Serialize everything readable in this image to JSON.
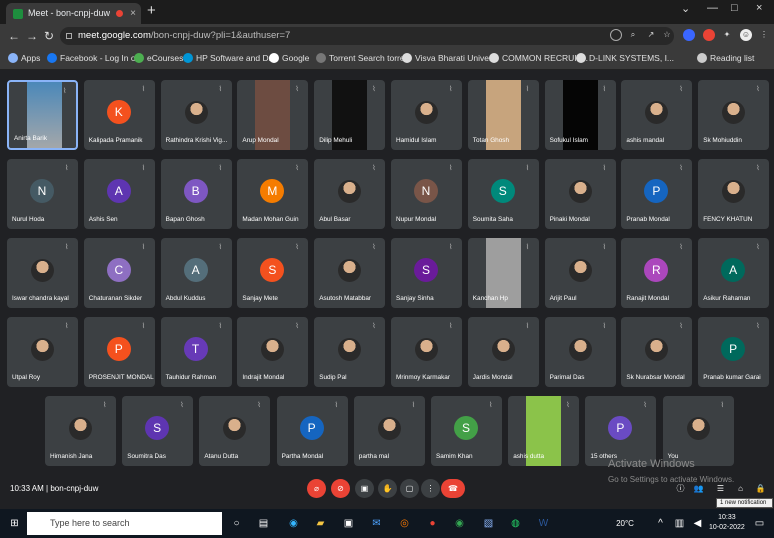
{
  "browser": {
    "tab_title": "Meet - bon-cnpj-duw",
    "url_host": "meet.google.com",
    "url_path": "/bon-cnpj-duw?pli=1&authuser=7",
    "bookmarks": [
      "Apps",
      "Facebook - Log In o...",
      "eCourses",
      "HP Software and Dr...",
      "Google",
      "Torrent Search torre...",
      "Visva Bharati Univer...",
      "COMMON RECRUIT...",
      "D-LINK SYSTEMS, I...",
      "Reading list"
    ]
  },
  "participants": [
    {
      "name": "Anirta Barik",
      "type": "self"
    },
    {
      "name": "Kalipada Pramanik",
      "initial": "K",
      "color": "#f4511e"
    },
    {
      "name": "Rathindra Krishi Vig...",
      "type": "photo"
    },
    {
      "name": "Arup Mondal",
      "type": "video",
      "video": "#6d4c41"
    },
    {
      "name": "Dilip Mehuli",
      "type": "video",
      "video": "#111111"
    },
    {
      "name": "Hamidul Islam",
      "type": "photo"
    },
    {
      "name": "Totan Ghosh",
      "type": "video",
      "video": "#c7a47d"
    },
    {
      "name": "Sofukul Islam",
      "type": "video",
      "video": "#050505"
    },
    {
      "name": "ashis mandal",
      "type": "photo"
    },
    {
      "name": "Sk Mohiuddin",
      "type": "photo"
    },
    {
      "name": "Nurul Hoda",
      "initial": "N",
      "color": "#455a64"
    },
    {
      "name": "Ashis Sen",
      "initial": "A",
      "color": "#5e35b1"
    },
    {
      "name": "Bapan Ghosh",
      "initial": "B",
      "color": "#7e57c2"
    },
    {
      "name": "Madan Mohan Guin",
      "initial": "M",
      "color": "#f57c00"
    },
    {
      "name": "Abul Basar",
      "type": "photo"
    },
    {
      "name": "Nupur Mondal",
      "initial": "N",
      "color": "#795548"
    },
    {
      "name": "Soumita Saha",
      "initial": "S",
      "color": "#00897b"
    },
    {
      "name": "Pinaki Mondal",
      "type": "photo"
    },
    {
      "name": "Pranab Mondal",
      "initial": "P",
      "color": "#1565c0"
    },
    {
      "name": "FENCY KHATUN",
      "type": "photo"
    },
    {
      "name": "Iswar chandra kayal",
      "type": "photo"
    },
    {
      "name": "Chaturanan Sikder",
      "initial": "C",
      "color": "#8e6fc2"
    },
    {
      "name": "Abdul Kuddus",
      "initial": "A",
      "color": "#546e7a"
    },
    {
      "name": "Sanjay Mete",
      "initial": "S",
      "color": "#f4511e"
    },
    {
      "name": "Asutosh Matabbar",
      "type": "photo"
    },
    {
      "name": "Sanjay Sinha",
      "initial": "S",
      "color": "#6a1b9a"
    },
    {
      "name": "Kanchan Hp",
      "type": "video",
      "video": "#9e9e9e"
    },
    {
      "name": "Arijit Paul",
      "type": "photo"
    },
    {
      "name": "Ranajit Mondal",
      "initial": "R",
      "color": "#ab47bc"
    },
    {
      "name": "Asikur Rahaman",
      "initial": "A",
      "color": "#00695c"
    },
    {
      "name": "Utpal Roy",
      "type": "photo"
    },
    {
      "name": "PROSENJIT MONDAL",
      "initial": "P",
      "color": "#f4511e"
    },
    {
      "name": "Tauhidur Rahman",
      "initial": "T",
      "color": "#673ab7"
    },
    {
      "name": "Indrajit Mondal",
      "type": "photo"
    },
    {
      "name": "Sudip Pal",
      "type": "photo"
    },
    {
      "name": "Mrinmoy Karmakar",
      "type": "photo"
    },
    {
      "name": "Jardis Mondal",
      "type": "photo"
    },
    {
      "name": "Parimal Das",
      "type": "photo"
    },
    {
      "name": "Sk Nurabsar Mondal",
      "type": "photo"
    },
    {
      "name": "Pranab kumar Garai",
      "initial": "P",
      "color": "#00695c"
    },
    {
      "name": "Himanish Jana",
      "type": "photo"
    },
    {
      "name": "Soumitra Das",
      "initial": "S",
      "color": "#5e35b1"
    },
    {
      "name": "Atanu Dutta",
      "type": "photo"
    },
    {
      "name": "Partha Mondal",
      "initial": "P",
      "color": "#1565c0"
    },
    {
      "name": "partha mal",
      "type": "photo"
    },
    {
      "name": "Samim Khan",
      "initial": "S",
      "color": "#43a047"
    },
    {
      "name": "ashis dutta",
      "type": "video",
      "video": "#8bc34a"
    },
    {
      "name": "15 others",
      "type": "others"
    },
    {
      "name": "You",
      "type": "photo"
    }
  ],
  "meeting": {
    "time": "10:33 AM",
    "code": "bon-cnpj-duw"
  },
  "watermark": {
    "line1": "Activate Windows",
    "line2": "Go to Settings to activate Windows."
  },
  "notification": "1 new notification",
  "taskbar": {
    "search": "Type here to search",
    "temperature": "20°C",
    "clock": "10:33",
    "date": "10-02-2022"
  }
}
